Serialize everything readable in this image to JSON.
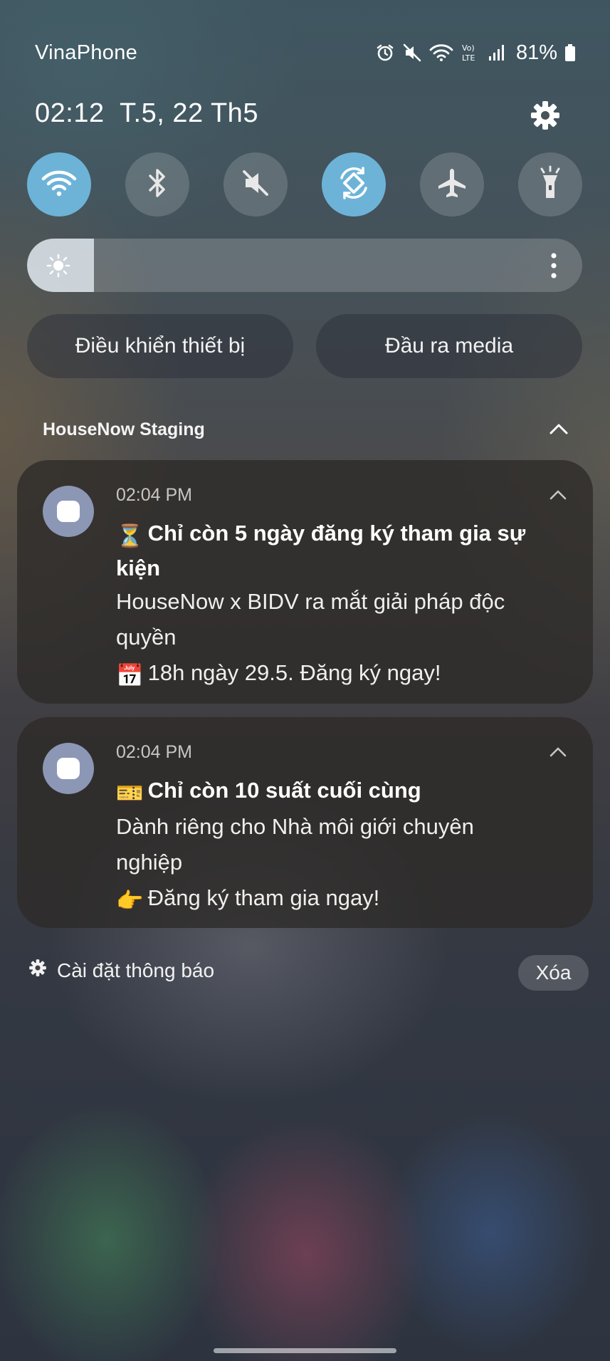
{
  "status_bar": {
    "carrier": "VinaPhone",
    "battery_percent": "81%",
    "icons": [
      "alarm-icon",
      "mute-icon",
      "wifi-icon",
      "volte-lte-icon",
      "signal-icon",
      "battery-icon"
    ]
  },
  "header": {
    "datetime": "02:12  T.5, 22 Th5",
    "settings_icon": "gear-icon"
  },
  "quick_toggles": [
    {
      "name": "wifi",
      "icon": "wifi-icon",
      "on": true
    },
    {
      "name": "bluetooth",
      "icon": "bluetooth-icon",
      "on": false
    },
    {
      "name": "sound",
      "icon": "mute-icon",
      "on": false
    },
    {
      "name": "auto-rotate",
      "icon": "rotate-icon",
      "on": true
    },
    {
      "name": "airplane",
      "icon": "airplane-icon",
      "on": false
    },
    {
      "name": "flashlight",
      "icon": "flashlight-icon",
      "on": false
    }
  ],
  "brightness": {
    "level": 0.12
  },
  "buttons": {
    "device_control": "Điều khiển thiết bị",
    "media_output": "Đầu ra media"
  },
  "notification_group": {
    "app_name": "HouseNow Staging",
    "notifications": [
      {
        "time": "02:04 PM",
        "title": "Chỉ còn 5 ngày đăng ký tham gia sự kiện",
        "title_emoji": "⏳",
        "lines": [
          "HouseNow x BIDV ra mắt giải pháp độc quyền"
        ],
        "last_line_emoji": "📅",
        "last_line": "18h ngày 29.5. Đăng ký ngay!"
      },
      {
        "time": "02:04 PM",
        "title": "Chỉ còn 10 suất cuối cùng",
        "title_emoji": "🎫",
        "lines": [
          "Dành riêng cho Nhà môi giới chuyên nghiệp"
        ],
        "last_line_emoji": "👉",
        "last_line": "Đăng ký tham gia ngay!"
      }
    ]
  },
  "footer": {
    "notification_settings": "Cài đặt thông báo",
    "clear": "Xóa"
  },
  "colors": {
    "toggle_on": "#6db3d8",
    "app_icon_bg": "#8b97b5"
  }
}
